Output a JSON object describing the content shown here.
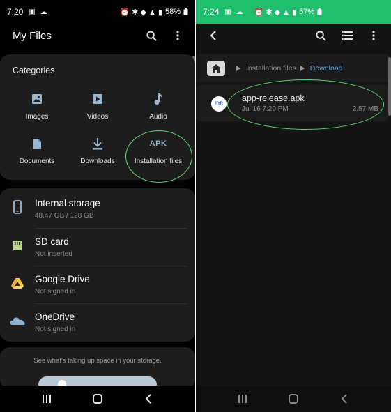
{
  "left": {
    "status": {
      "time": "7:20",
      "battery": "58%"
    },
    "appbar": {
      "title": "My Files",
      "search_icon": "search-icon",
      "menu_icon": "more-vert-icon"
    },
    "categories": {
      "heading": "Categories",
      "items": [
        {
          "label": "Images",
          "icon": "image-icon"
        },
        {
          "label": "Videos",
          "icon": "video-icon"
        },
        {
          "label": "Audio",
          "icon": "music-note-icon"
        },
        {
          "label": "Documents",
          "icon": "document-icon"
        },
        {
          "label": "Downloads",
          "icon": "download-icon"
        },
        {
          "label": "Installation files",
          "icon": "apk-icon",
          "icon_text": "APK"
        }
      ]
    },
    "storage": [
      {
        "title": "Internal storage",
        "subtitle": "48.47 GB / 128 GB",
        "icon": "phone-icon"
      },
      {
        "title": "SD card",
        "subtitle": "Not inserted",
        "icon": "sd-card-icon"
      },
      {
        "title": "Google Drive",
        "subtitle": "Not signed in",
        "icon": "google-drive-icon"
      },
      {
        "title": "OneDrive",
        "subtitle": "Not signed in",
        "icon": "onedrive-icon"
      }
    ],
    "hint": "See what's taking up space in your storage."
  },
  "right": {
    "status": {
      "time": "7:24",
      "battery": "57%"
    },
    "breadcrumb": {
      "items": [
        "Installation files",
        "Download"
      ]
    },
    "file": {
      "name": "app-release.apk",
      "date": "Jul 16 7:20 PM",
      "size": "2.57 MB",
      "icon_text": "RYR"
    }
  },
  "colors": {
    "right_status_bar": "#1fbe6e",
    "accent_icon": "#9bb5cf",
    "annotation": "#5cd86d",
    "breadcrumb_active": "#6fa7d6"
  }
}
